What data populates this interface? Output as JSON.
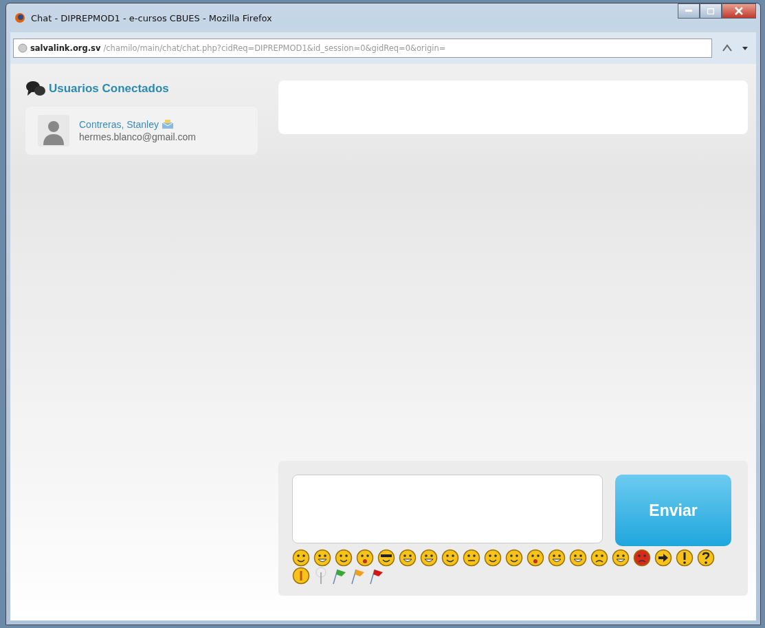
{
  "window": {
    "title": "Chat - DIPREPMOD1 - e-cursos CBUES - Mozilla Firefox"
  },
  "address_bar": {
    "host": "salvalink.org.sv",
    "path": "/chamilo/main/chat/chat.php?cidReq=DIPREPMOD1&id_session=0&gidReq=0&origin="
  },
  "sidebar": {
    "title": "Usuarios Conectados",
    "users": [
      {
        "name": "Contreras, Stanley",
        "email": "hermes.blanco@gmail.com"
      }
    ]
  },
  "composer": {
    "send_button": "Enviar"
  }
}
